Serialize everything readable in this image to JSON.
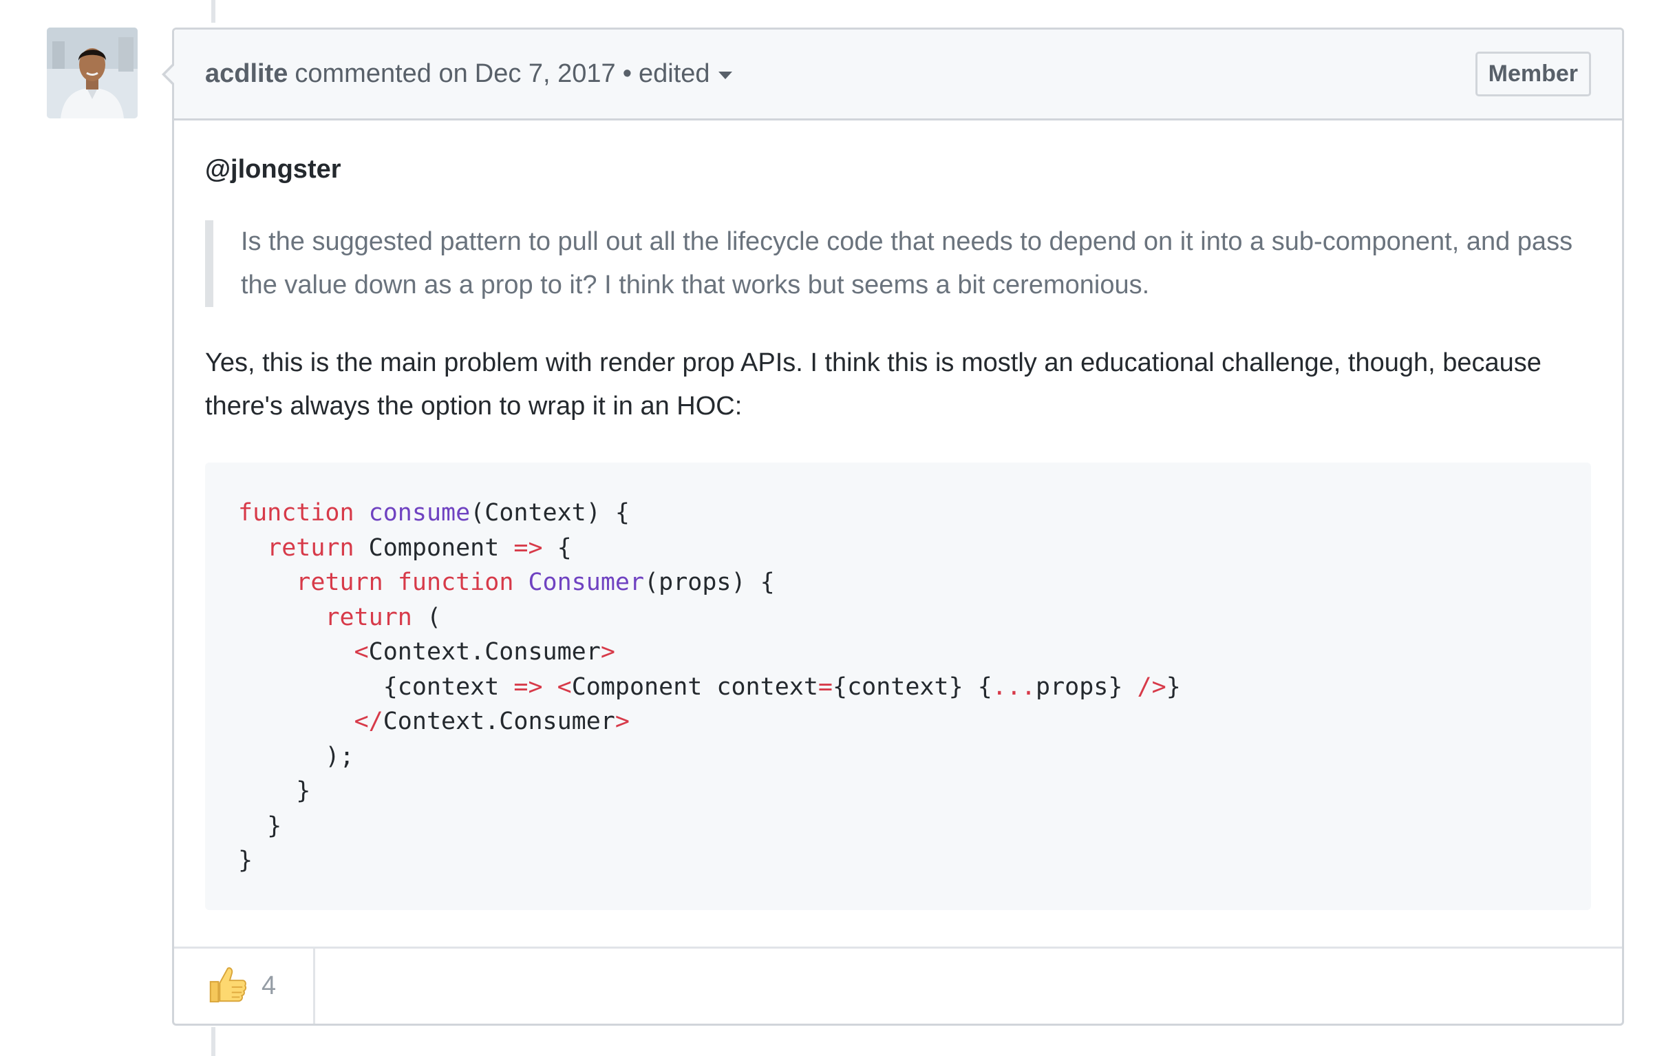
{
  "comment": {
    "author": "acdlite",
    "action": "commented on",
    "date": "Dec 7, 2017",
    "separator": "•",
    "edited_label": "edited",
    "role_badge": "Member",
    "mention": "@jlongster",
    "quote": "Is the suggested pattern to pull out all the lifecycle code that needs to depend on it into a sub-component, and pass the value down as a prop to it? I think that works but seems a bit ceremonious.",
    "body_text": "Yes, this is the main problem with render prop APIs. I think this is mostly an educational challenge, though, because there's always the option to wrap it in an HOC:",
    "code": {
      "l1_kw": "function",
      "l1_fn": "consume",
      "l1_rest": "(Context) {",
      "l2_kw": "return",
      "l2_a": " Component ",
      "l2_op": "=>",
      "l2_b": " {",
      "l3_kw1": "return",
      "l3_kw2": "function",
      "l3_fn": "Consumer",
      "l3_rest": "(props) {",
      "l4_kw": "return",
      "l4_rest": " (",
      "l5_lt": "<",
      "l5_tag": "Context.Consumer",
      "l5_gt": ">",
      "l6_a": "{context ",
      "l6_op": "=>",
      "l6_b": " ",
      "l6_lt": "<",
      "l6_tag": "Component context",
      "l6_eq": "=",
      "l6_c": "{context} {",
      "l6_spread": "...",
      "l6_d": "props} ",
      "l6_close": "/>",
      "l6_e": "}",
      "l7_lt": "</",
      "l7_tag": "Context.Consumer",
      "l7_gt": ">",
      "l8": ");",
      "l9": "}",
      "l10": "}",
      "l11": "}"
    },
    "reactions": [
      {
        "emoji": "👍",
        "icon": "thumbs-up-icon",
        "count": "4"
      }
    ]
  },
  "colors": {
    "keyword": "#d73a49",
    "function_name": "#6f42c1",
    "header_bg": "#f6f8fa",
    "border": "#d1d5da"
  }
}
